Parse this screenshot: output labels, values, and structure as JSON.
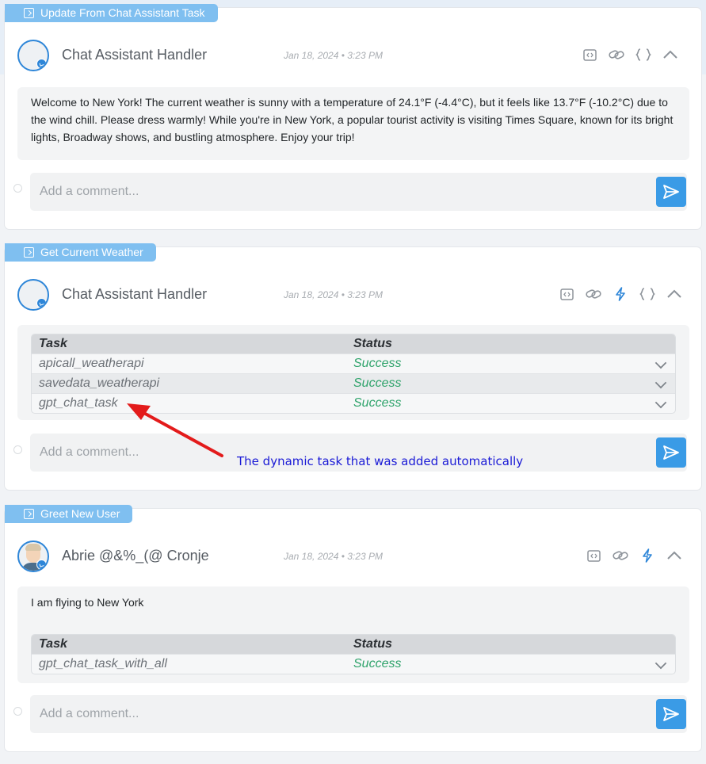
{
  "colors": {
    "accent": "#2e86d8",
    "tag": "#7fbff0",
    "send": "#3a9be6",
    "success": "#2fa36b",
    "annotation_text": "#1a1ad6",
    "arrow": "#e31b1b"
  },
  "icons": [
    "tag-icon",
    "bot-avatar",
    "user-avatar",
    "code-icon",
    "link-icon",
    "bolt-icon",
    "braces-icon",
    "chevron-up-icon",
    "chevron-down-icon",
    "send-icon"
  ],
  "cards": [
    {
      "tag": "Update From Chat Assistant Task",
      "author": "Chat Assistant Handler",
      "timestamp": "Jan 18, 2024 • 3:23 PM",
      "message": "Welcome to New York! The current weather is sunny with a temperature of 24.1°F (-4.4°C), but it feels like 13.7°F (-10.2°C) due to the wind chill. Please dress warmly! While you're in New York, a popular tourist activity is visiting Times Square, known for its bright lights, Broadway shows, and bustling atmosphere. Enjoy your trip!",
      "comment_placeholder": "Add a comment..."
    },
    {
      "tag": "Get Current Weather",
      "author": "Chat Assistant Handler",
      "timestamp": "Jan 18, 2024 • 3:23 PM",
      "table": {
        "headers": [
          "Task",
          "Status"
        ],
        "rows": [
          [
            "apicall_weatherapi",
            "Success"
          ],
          [
            "savedata_weatherapi",
            "Success"
          ],
          [
            "gpt_chat_task",
            "Success"
          ]
        ]
      },
      "comment_placeholder": "Add a comment..."
    },
    {
      "tag": "Greet New User",
      "author": "Abrie @&%_(@ Cronje",
      "timestamp": "Jan 18, 2024 • 3:23 PM",
      "message": "I am flying to New York",
      "table": {
        "headers": [
          "Task",
          "Status"
        ],
        "rows": [
          [
            "gpt_chat_task_with_all",
            "Success"
          ]
        ]
      },
      "comment_placeholder": "Add a comment..."
    }
  ],
  "annotation": "The dynamic task that was added automatically"
}
